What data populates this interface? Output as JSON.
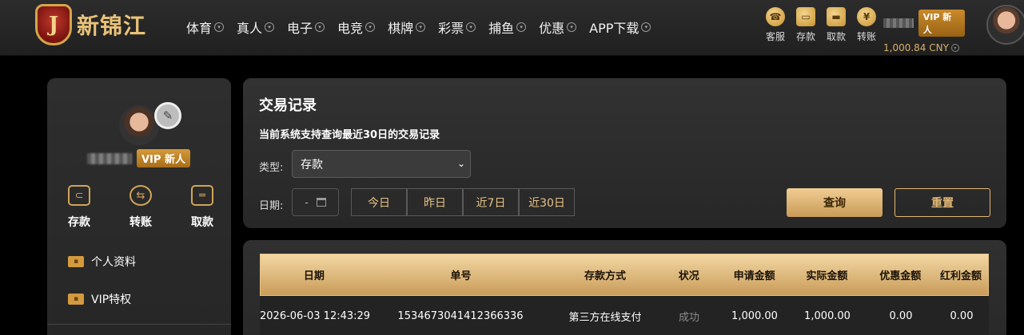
{
  "brand": {
    "logo_letter": "J",
    "name": "新锦江"
  },
  "nav": [
    "体育",
    "真人",
    "电子",
    "电竞",
    "棋牌",
    "彩票",
    "捕鱼",
    "优惠",
    "APP下载"
  ],
  "quick_actions": [
    {
      "label": "客服",
      "icon": "headset-icon"
    },
    {
      "label": "存款",
      "icon": "wallet-icon"
    },
    {
      "label": "取款",
      "icon": "briefcase-icon"
    },
    {
      "label": "转账",
      "icon": "exchange-icon"
    }
  ],
  "user": {
    "vip": "VIP 新人",
    "balance": "1,000.84 CNY"
  },
  "sidebar": {
    "vip": "VIP 新人",
    "actions": [
      {
        "label": "存款",
        "icon": "wallet-icon"
      },
      {
        "label": "转账",
        "icon": "transfer-icon"
      },
      {
        "label": "取款",
        "icon": "card-icon"
      }
    ],
    "menu": [
      {
        "label": "个人资料",
        "icon": "id-card-icon"
      },
      {
        "label": "VIP特权",
        "icon": "vip-card-icon"
      }
    ]
  },
  "query": {
    "title": "交易记录",
    "subtitle": "当前系统支持查询最近30日的交易记录",
    "type_label": "类型:",
    "type_value": "存款",
    "date_label": "日期:",
    "date_value": "-",
    "ranges": [
      "今日",
      "昨日",
      "近7日",
      "近30日"
    ],
    "query_label": "查询",
    "reset_label": "重置"
  },
  "table": {
    "columns": [
      "日期",
      "单号",
      "存款方式",
      "状况",
      "申请金额",
      "实际金额",
      "优惠金额",
      "红利金额"
    ],
    "rows": [
      [
        "2026-06-03 12:43:29",
        "1534673041412366336",
        "第三方在线支付",
        "成功",
        "1,000.00",
        "1,000.00",
        "0.00",
        "0.00"
      ]
    ]
  }
}
